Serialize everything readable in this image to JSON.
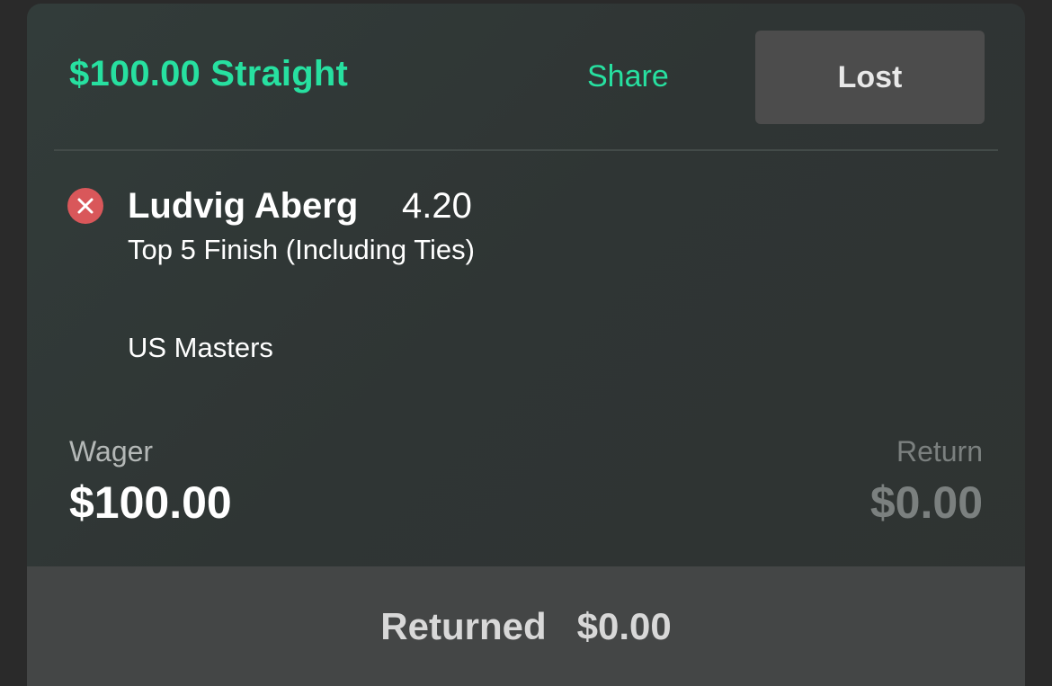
{
  "bet": {
    "title": "$100.00 Straight",
    "share_label": "Share",
    "status": "Lost"
  },
  "selection": {
    "status_icon": "close-icon",
    "name": "Ludvig Aberg",
    "odds": "4.20",
    "market": "Top 5 Finish (Including Ties)",
    "event": "US Masters"
  },
  "summary": {
    "wager_label": "Wager",
    "wager_value": "$100.00",
    "return_label": "Return",
    "return_value": "$0.00"
  },
  "footer": {
    "returned_label": "Returned",
    "returned_value": "$0.00"
  },
  "colors": {
    "accent": "#27e0a0",
    "lost_icon": "#d9575a",
    "badge_bg": "#4c4c4c",
    "footer_bg": "#444646",
    "card_bg": "#2f3534"
  }
}
